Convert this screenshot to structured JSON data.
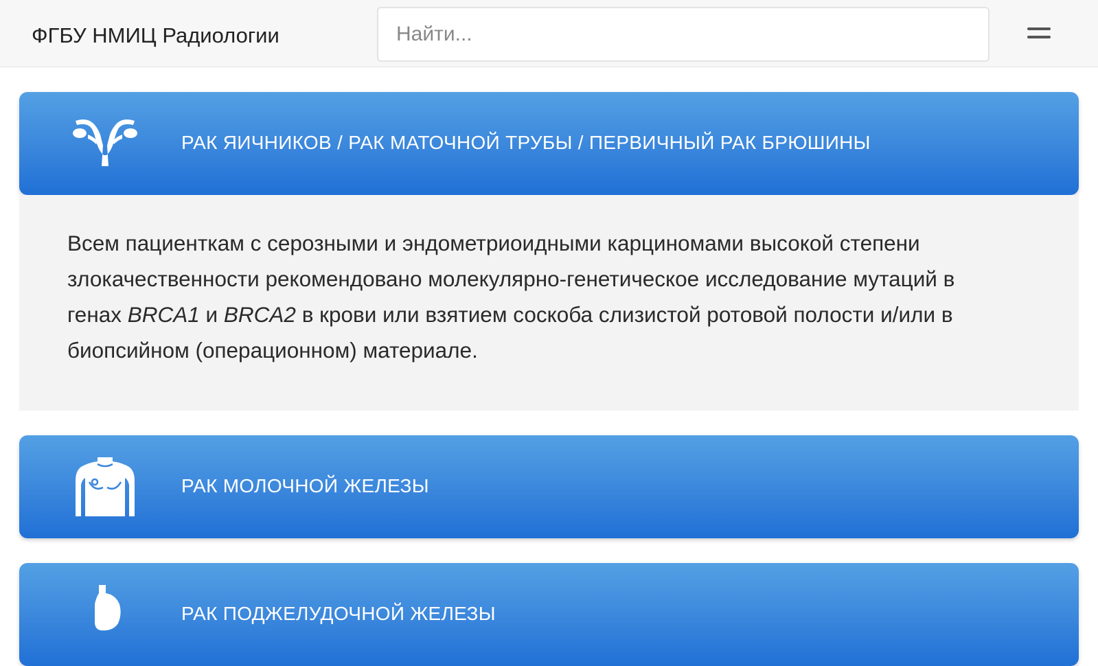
{
  "header": {
    "brand": "ФГБУ НМИЦ Радиологии",
    "search_placeholder": "Найти...",
    "menu_icon": "hamburger-icon"
  },
  "accent_colors": {
    "card_top": "#54a0e4",
    "card_bottom": "#2070d6",
    "panel_bg": "#f3f3f4"
  },
  "categories": [
    {
      "title": "РАК ЯИЧНИКОВ / РАК МАТОЧНОЙ ТРУБЫ / ПЕРВИЧНЫЙ РАК БРЮШИНЫ",
      "icon": "uterus-icon",
      "expanded": true,
      "body": {
        "t1": "Всем пациенткам с серозными и эндометриоидными карциномами высокой степени злокачественности рекомендовано молекулярно-генетическое исследование мутаций в генах ",
        "gene1": "BRCA1",
        "t2": " и ",
        "gene2": "BRCA2",
        "t3": " в крови или взятием соскоба слизистой ротовой полости и/или в биопсийном (операционном) материале."
      }
    },
    {
      "title": "РАК МОЛОЧНОЙ ЖЕЛЕЗЫ",
      "icon": "female-torso-icon",
      "expanded": false
    },
    {
      "title": "РАК ПОДЖЕЛУДОЧНОЙ ЖЕЛЕЗЫ",
      "icon": "pancreas-icon",
      "expanded": false
    }
  ]
}
